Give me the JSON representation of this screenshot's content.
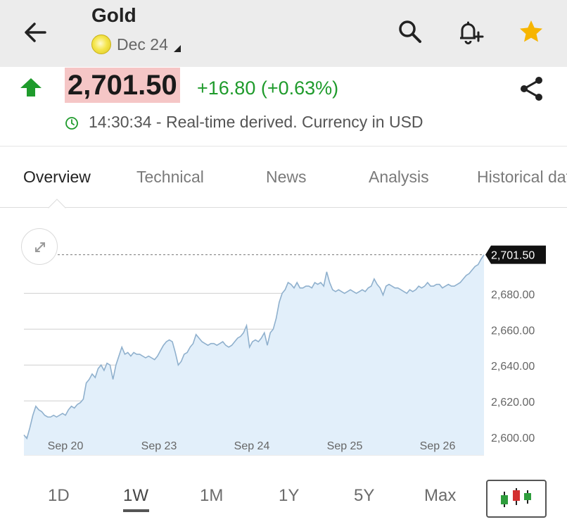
{
  "header": {
    "title": "Gold",
    "contract": "Dec 24"
  },
  "quote": {
    "price": "2,701.50",
    "change": "+16.80 (+0.63%)",
    "status": "14:30:34 - Real-time derived. Currency in USD",
    "direction": "up"
  },
  "tabs": [
    {
      "label": "Overview",
      "active": true
    },
    {
      "label": "Technical",
      "active": false
    },
    {
      "label": "News",
      "active": false
    },
    {
      "label": "Analysis",
      "active": false
    },
    {
      "label": "Historical data",
      "active": false
    }
  ],
  "colors": {
    "up_green": "#1f9b2c",
    "price_highlight": "#f5c6c6",
    "line": "#8fb0cd",
    "area": "#e2effa",
    "star": "#f7b500",
    "candle_red": "#d32f2f",
    "candle_green": "#2e9d3c"
  },
  "chart_data": {
    "type": "area",
    "y_ticks": [
      "2,600.00",
      "2,620.00",
      "2,640.00",
      "2,660.00",
      "2,680.00"
    ],
    "y_tick_values": [
      2600,
      2620,
      2640,
      2660,
      2680
    ],
    "x_ticks": [
      "Sep 20",
      "Sep 23",
      "Sep 24",
      "Sep 25",
      "Sep 26"
    ],
    "last_value_label": "2,701.50",
    "last_value": 2701.5,
    "ylim": [
      2590,
      2710
    ],
    "grid": true,
    "values": [
      2601,
      2599,
      2605,
      2612,
      2617,
      2615,
      2614,
      2612,
      2611,
      2611,
      2612,
      2611,
      2612,
      2613,
      2612,
      2615,
      2617,
      2616,
      2618,
      2619,
      2621,
      2630,
      2632,
      2635,
      2633,
      2638,
      2640,
      2637,
      2641,
      2640,
      2632,
      2640,
      2645,
      2650,
      2646,
      2647,
      2645,
      2647,
      2646,
      2646,
      2645,
      2644,
      2645,
      2644,
      2643,
      2645,
      2648,
      2651,
      2653,
      2654,
      2653,
      2647,
      2640,
      2642,
      2646,
      2647,
      2650,
      2652,
      2657,
      2655,
      2653,
      2652,
      2651,
      2652,
      2652,
      2651,
      2652,
      2653,
      2651,
      2650,
      2651,
      2653,
      2655,
      2656,
      2658,
      2662,
      2650,
      2653,
      2654,
      2653,
      2655,
      2658,
      2651,
      2658,
      2660,
      2666,
      2675,
      2680,
      2682,
      2686,
      2685,
      2683,
      2686,
      2683,
      2683,
      2684,
      2684,
      2683,
      2686,
      2685,
      2686,
      2684,
      2692,
      2686,
      2682,
      2681,
      2682,
      2681,
      2680,
      2681,
      2682,
      2681,
      2680,
      2681,
      2682,
      2681,
      2683,
      2684,
      2688,
      2685,
      2683,
      2679,
      2684,
      2685,
      2684,
      2683,
      2683,
      2682,
      2681,
      2680,
      2682,
      2681,
      2682,
      2684,
      2683,
      2684,
      2686,
      2684,
      2684,
      2685,
      2685,
      2683,
      2684,
      2685,
      2684,
      2684,
      2685,
      2686,
      2688,
      2690,
      2691,
      2693,
      2695,
      2696,
      2699,
      2701.5
    ]
  },
  "ranges": [
    {
      "label": "1D",
      "active": false
    },
    {
      "label": "1W",
      "active": true
    },
    {
      "label": "1M",
      "active": false
    },
    {
      "label": "1Y",
      "active": false
    },
    {
      "label": "5Y",
      "active": false
    },
    {
      "label": "Max",
      "active": false
    }
  ]
}
